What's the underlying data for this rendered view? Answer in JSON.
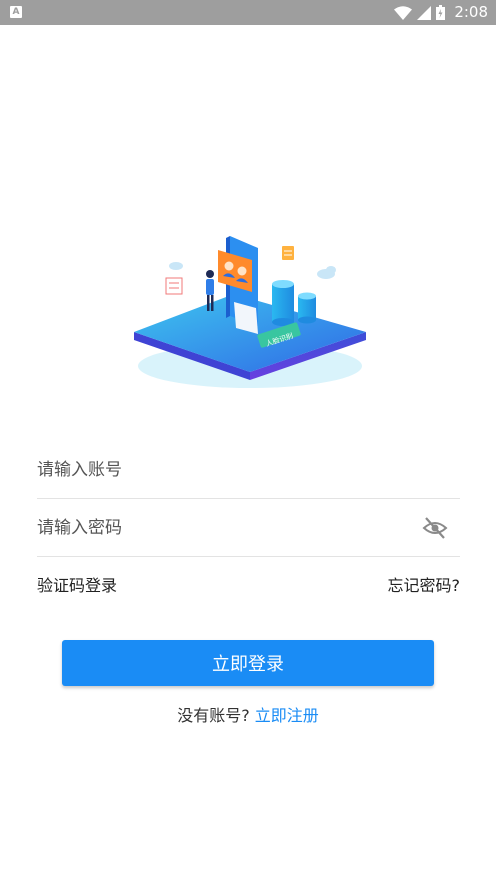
{
  "status_bar": {
    "app_indicator": "A",
    "time": "2:08",
    "icons": [
      "wifi-icon",
      "cellular-signal-icon",
      "battery-icon"
    ]
  },
  "hero": {
    "illustration": "face-recognition-isometric-illustration",
    "badge_text": "人脸识别"
  },
  "form": {
    "account_placeholder": "请输入账号",
    "password_placeholder": "请输入密码",
    "password_visibility_icon": "eye-off-icon",
    "sms_login_label": "验证码登录",
    "forgot_password_label": "忘记密码?",
    "login_button_label": "立即登录",
    "no_account_prompt": "没有账号?",
    "register_link_label": "立即注册"
  },
  "colors": {
    "primary": "#1a8cf5",
    "status_bar": "#9e9e9e",
    "divider": "#e3e3e3"
  }
}
